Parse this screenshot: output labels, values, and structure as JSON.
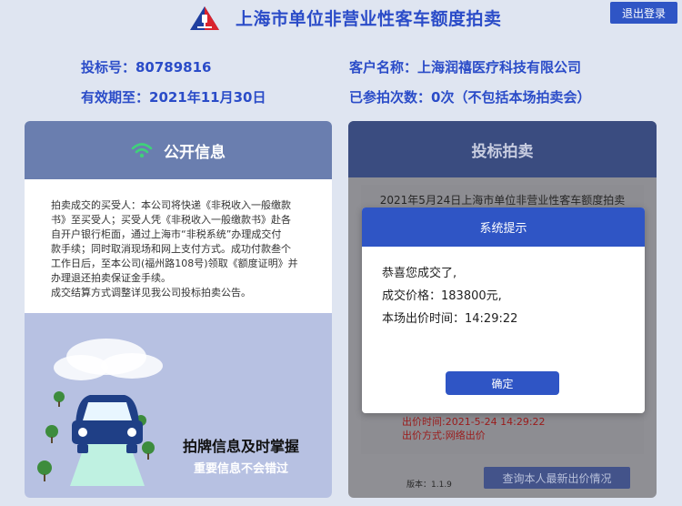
{
  "header": {
    "title": "上海市单位非营业性客车额度拍卖",
    "logout_label": "退出登录",
    "colors": {
      "brand": "#2b4cc8",
      "button": "#2f55c5"
    }
  },
  "bidder_info": {
    "bid_no": "投标号：80789816",
    "valid_until": "有效期至：2021年11月30日",
    "client_name": "客户名称：上海润禧医疗科技有限公司",
    "attempts": "已参拍次数：0次（不包括本场拍卖会）"
  },
  "public_info": {
    "title": "公开信息",
    "icon": "wifi-icon",
    "notice": [
      "拍卖成交的买受人：本公司将快递《非税收入一般缴款",
      "书》至买受人；买受人凭《非税收入一般缴款书》赴各",
      "自开户银行柜面，通过上海市“非税系统”办理成交付",
      "款手续；同时取消现场和网上支付方式。成功付款叁个",
      "工作日后，至本公司(福州路108号)领取《额度证明》并",
      "办理退还拍卖保证金手续。",
      "成交结算方式调整详见我公司投标拍卖公告。"
    ],
    "promo_title": "拍牌信息及时掌握",
    "promo_subtitle": "重要信息不会错过"
  },
  "bidding": {
    "title": "投标拍卖",
    "line": "2021年5月24日上海市单位非营业性客车额度拍卖",
    "bid_time": "出价时间:2021-5-24 14:29:22",
    "bid_method": "出价方式:网络出价",
    "version": "版本：1.1.9",
    "query_label": "查询本人最新出价情况"
  },
  "modal": {
    "title": "系统提示",
    "line1": "恭喜您成交了,",
    "line2": "成交价格：183800元,",
    "line3": "本场出价时间：14:29:22",
    "confirm_label": "确定"
  }
}
